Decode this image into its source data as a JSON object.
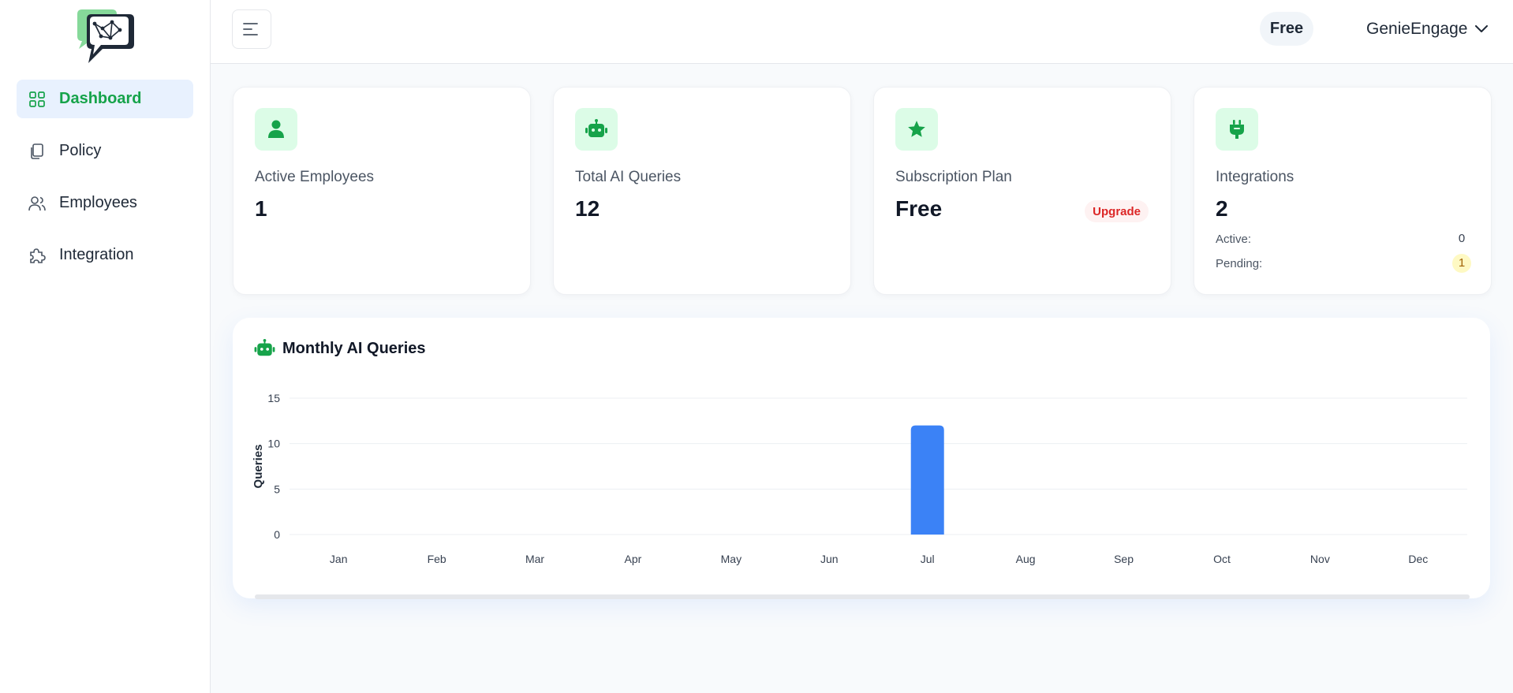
{
  "header": {
    "plan_badge": "Free",
    "account_name": "GenieEngage"
  },
  "sidebar": {
    "items": [
      {
        "label": "Dashboard",
        "icon": "grid-icon",
        "active": true
      },
      {
        "label": "Policy",
        "icon": "copy-icon",
        "active": false
      },
      {
        "label": "Employees",
        "icon": "users-icon",
        "active": false
      },
      {
        "label": "Integration",
        "icon": "puzzle-icon",
        "active": false
      }
    ]
  },
  "cards": {
    "employees": {
      "label": "Active Employees",
      "value": "1",
      "icon": "user-icon"
    },
    "queries": {
      "label": "Total AI Queries",
      "value": "12",
      "icon": "robot-icon"
    },
    "plan": {
      "label": "Subscription Plan",
      "value": "Free",
      "action": "Upgrade",
      "icon": "star-icon"
    },
    "integrations": {
      "label": "Integrations",
      "value": "2",
      "icon": "plug-icon",
      "active_label": "Active:",
      "active_count": "0",
      "pending_label": "Pending:",
      "pending_count": "1"
    }
  },
  "colors": {
    "accent": "#16a34a",
    "accent_bg": "#dcfce7",
    "bar": "#3b82f6",
    "nav_active_bg": "#e8f1fe",
    "upgrade": "#dc2626"
  },
  "chart_data": {
    "type": "bar",
    "title": "Monthly AI Queries",
    "xlabel": "",
    "ylabel": "Queries",
    "categories": [
      "Jan",
      "Feb",
      "Mar",
      "Apr",
      "May",
      "Jun",
      "Jul",
      "Aug",
      "Sep",
      "Oct",
      "Nov",
      "Dec"
    ],
    "values": [
      0,
      0,
      0,
      0,
      0,
      0,
      12,
      0,
      0,
      0,
      0,
      0
    ],
    "ylim": [
      0,
      15
    ],
    "yticks": [
      0,
      5,
      10,
      15
    ],
    "grid": true,
    "legend": "none"
  }
}
